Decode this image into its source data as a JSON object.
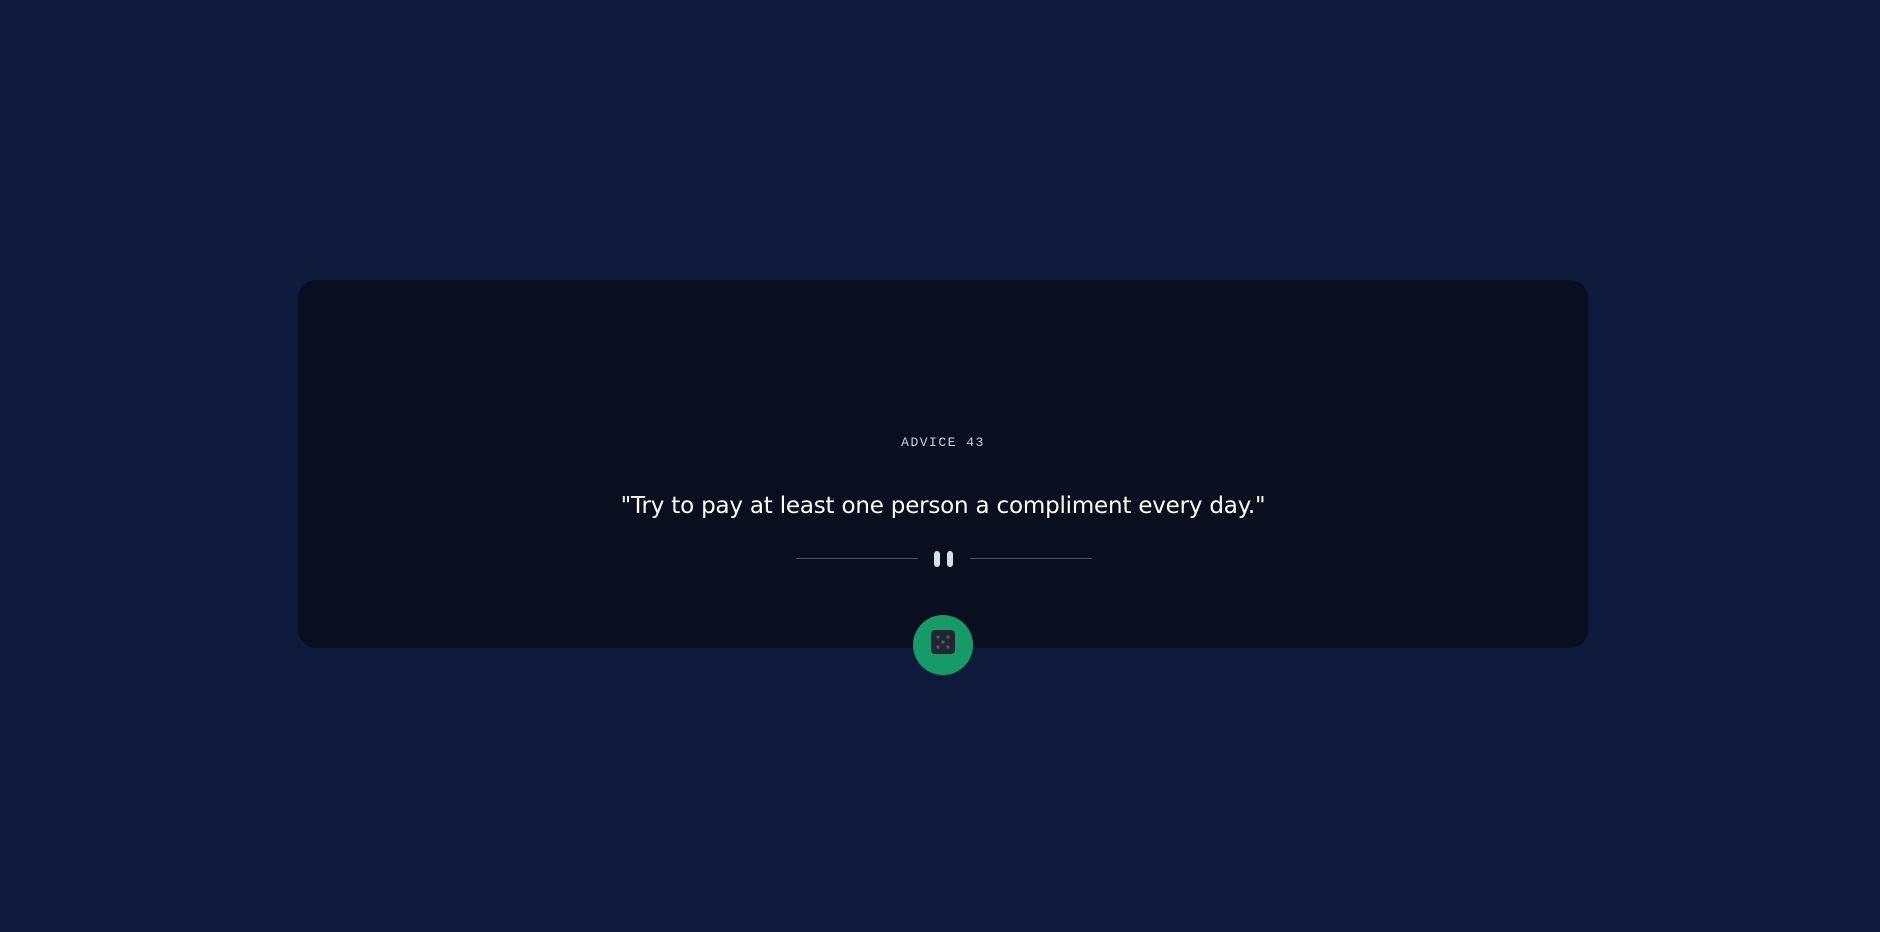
{
  "advice": {
    "label": "ADVICE 43",
    "quote": "\"Try to pay at least one person a compliment every day.\""
  },
  "divider": {
    "icon": "pause-icon"
  },
  "generate_button": {
    "icon": "dice-icon",
    "color": "#169a67"
  },
  "colors": {
    "background": "#0f193b",
    "card": "#0a0f1f",
    "accent": "#169a67"
  }
}
